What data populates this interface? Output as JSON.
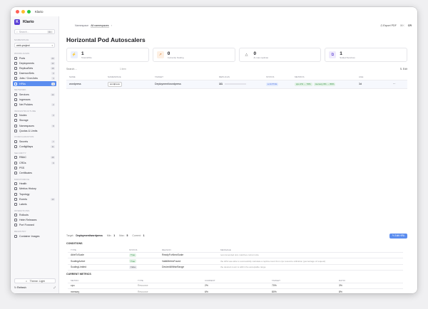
{
  "window": {
    "app_title": "Klario",
    "dot_colors": [
      "#ff5f57",
      "#febc2e",
      "#28c840"
    ]
  },
  "topbar": {
    "breadcrumb": [
      "Namespace",
      "All namespaces",
      "›"
    ],
    "export_label": "Export PDF",
    "zoom_label": "⌘K",
    "user_label": "CR"
  },
  "sidebar": {
    "brand": "Klario",
    "search_placeholder": "Search…",
    "search_kbd": "⌘K",
    "namespace_label": "Namespace",
    "namespace_value": "web-project",
    "groups": [
      {
        "label": "Workloads",
        "items": [
          {
            "label": "Pods",
            "count": "24"
          },
          {
            "label": "Deployments",
            "count": "12"
          },
          {
            "label": "ReplicaSets",
            "count": "18"
          },
          {
            "label": "DaemonSets",
            "count": "3"
          },
          {
            "label": "Jobs / CronJobs",
            "count": "4"
          },
          {
            "label": "HPAs",
            "count": "1",
            "active": true
          }
        ]
      },
      {
        "label": "Network",
        "items": [
          {
            "label": "Services",
            "count": "14"
          },
          {
            "label": "Ingresses",
            "count": ""
          },
          {
            "label": "Net Policies",
            "count": "2"
          }
        ]
      },
      {
        "label": "Infrastructure",
        "items": [
          {
            "label": "Nodes",
            "count": "3"
          },
          {
            "label": "Storage",
            "count": ""
          },
          {
            "label": "Namespaces",
            "count": "8"
          },
          {
            "label": "Quotas & Limits",
            "count": ""
          }
        ]
      },
      {
        "label": "Configuration",
        "items": [
          {
            "label": "Secrets",
            "count": "7"
          },
          {
            "label": "ConfigMaps",
            "count": "11"
          }
        ]
      },
      {
        "label": "Security",
        "items": [
          {
            "label": "RBAC",
            "count": "48"
          },
          {
            "label": "CRDs",
            "count": "9"
          },
          {
            "label": "PSS",
            "count": ""
          },
          {
            "label": "Certificates",
            "count": ""
          }
        ]
      },
      {
        "label": "Monitoring",
        "items": [
          {
            "label": "Health",
            "count": ""
          },
          {
            "label": "Metrics History",
            "count": ""
          },
          {
            "label": "Topology",
            "count": ""
          },
          {
            "label": "Events",
            "count": "13"
          },
          {
            "label": "Labels",
            "count": ""
          }
        ]
      },
      {
        "label": "Operations",
        "items": [
          {
            "label": "Rollouts",
            "count": ""
          },
          {
            "label": "Helm Releases",
            "count": ""
          },
          {
            "label": "Port Forward",
            "count": ""
          }
        ]
      },
      {
        "label": "Registry",
        "items": [
          {
            "label": "Container Images",
            "count": ""
          }
        ]
      }
    ],
    "theme_label": "Theme: Light",
    "footer_left": "Refresh",
    "footer_right": "⤢"
  },
  "main": {
    "title": "Horizontal Pod Autoscalers",
    "stats": [
      {
        "value": "1",
        "label": "Total HPAs",
        "icon": "⚡",
        "bg": "#eaf0fe",
        "fg": "#4a6fe0"
      },
      {
        "value": "0",
        "label": "Currently Scaling",
        "icon": "↗",
        "bg": "#fdf0e4",
        "fg": "#d87a2b"
      },
      {
        "value": "0",
        "label": "At max replicas",
        "icon": "△",
        "bg": "#ffffff",
        "fg": "#555"
      },
      {
        "value": "1",
        "label": "Scaled Services",
        "icon": "⧉",
        "bg": "#efeafc",
        "fg": "#6a4fd6"
      }
    ],
    "filter_placeholder": "Search…",
    "filter_count": "1 item",
    "edit_label": "⇅ Edit",
    "table": {
      "headers": [
        "Name",
        "Namespace",
        "Target",
        "Replicas",
        "Status",
        "Metrics",
        "Age",
        ""
      ],
      "rows": [
        {
          "name": "wordpress",
          "namespace": "wordpress",
          "target": "Deployment/wordpress",
          "replicas": "1/1",
          "status": "ACTIVE",
          "metrics_cpu": "cpu 2% → 70%",
          "metrics_mem": "memory 6% → 80%",
          "age": "3d",
          "actions": "⋯"
        }
      ]
    },
    "detail": {
      "target_label": "Target:",
      "target_value": "Deployment/wordpress",
      "min_label": "Min:",
      "min_value": "1",
      "max_label": "Max:",
      "max_value": "5",
      "current_label": "Current:",
      "current_value": "1",
      "edit_button": "✎ Edit HPA"
    },
    "conditions": {
      "title": "Conditions",
      "headers": [
        "Type",
        "Status",
        "Reason",
        "Message"
      ],
      "rows": [
        {
          "type": "AbleToScale",
          "status": "True",
          "status_kind": "true",
          "reason": "ReadyForNewScale",
          "message": "recommended size matches current size"
        },
        {
          "type": "ScalingActive",
          "status": "True",
          "status_kind": "true",
          "reason": "ValidMetricFound",
          "message": "the HPA was able to successfully calculate a replica count from cpu resource utilization (percentage of request)"
        },
        {
          "type": "ScalingLimited",
          "status": "False",
          "status_kind": "false",
          "reason": "DesiredWithinRange",
          "message": "the desired count is within the acceptable range"
        }
      ]
    },
    "metrics": {
      "title": "Current Metrics",
      "headers": [
        "Metric",
        "Type",
        "Current",
        "Target",
        "Ratio"
      ],
      "rows": [
        {
          "metric": "cpu",
          "type": "Resource",
          "current": "2%",
          "target": "70%",
          "ratio": "3%"
        },
        {
          "metric": "memory",
          "type": "Resource",
          "current": "6%",
          "target": "80%",
          "ratio": "8%"
        }
      ]
    }
  }
}
